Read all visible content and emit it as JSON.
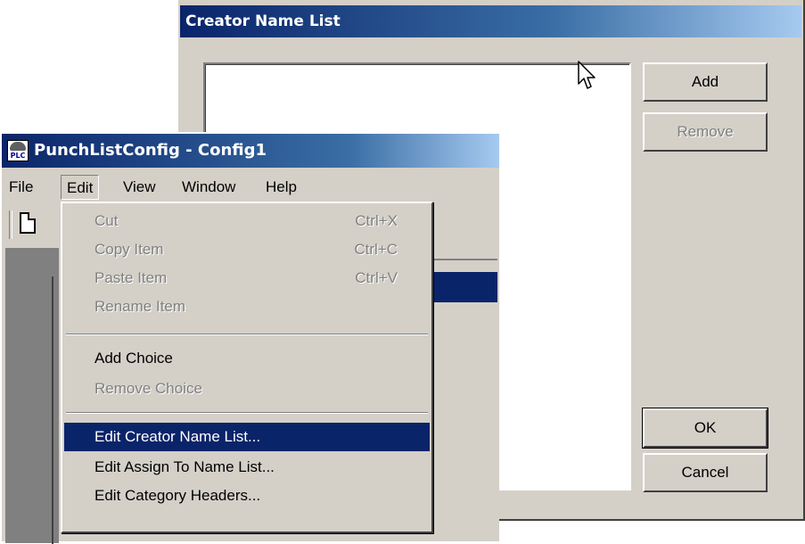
{
  "dialog": {
    "title": "Creator Name List",
    "add_label": "Add",
    "remove_label": "Remove",
    "ok_label": "OK",
    "cancel_label": "Cancel"
  },
  "app": {
    "title": "PunchListConfig - Config1",
    "icon_text": "PLC",
    "menu": [
      "File",
      "Edit",
      "View",
      "Window",
      "Help"
    ]
  },
  "edit_menu": {
    "items": [
      {
        "label": "Cut",
        "shortcut": "Ctrl+X",
        "enabled": false
      },
      {
        "label": "Copy Item",
        "shortcut": "Ctrl+C",
        "enabled": false
      },
      {
        "label": "Paste Item",
        "shortcut": "Ctrl+V",
        "enabled": false
      },
      {
        "label": "Rename Item",
        "shortcut": "",
        "enabled": false
      },
      {
        "label": "Add Choice",
        "shortcut": "",
        "enabled": true
      },
      {
        "label": "Remove Choice",
        "shortcut": "",
        "enabled": false
      },
      {
        "label": "Edit Creator Name List...",
        "shortcut": "",
        "enabled": true,
        "selected": true
      },
      {
        "label": "Edit Assign To Name List...",
        "shortcut": "",
        "enabled": true
      },
      {
        "label": "Edit Category Headers...",
        "shortcut": "",
        "enabled": true
      }
    ]
  },
  "colors": {
    "title_active": "#0a246a",
    "face": "#d4d0c8",
    "highlight": "#0a246a"
  }
}
